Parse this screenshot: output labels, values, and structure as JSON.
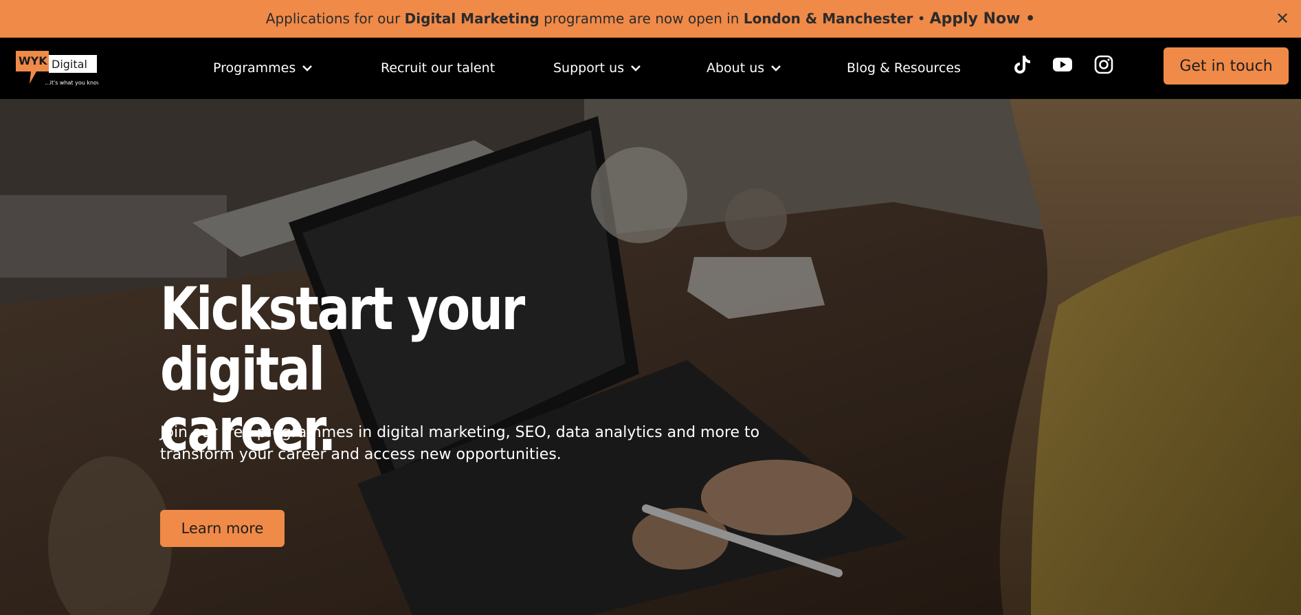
{
  "announcement": {
    "prefix": "Applications for our",
    "programme": "Digital Marketing",
    "middle": "programme are now open in",
    "locations": "London & Manchester",
    "separator": "•",
    "apply_label": "Apply Now",
    "apply_suffix": "•",
    "close_icon": "close-icon"
  },
  "logo": {
    "brand": "WYK",
    "word": "Digital",
    "tagline": "...it's what you know"
  },
  "nav": {
    "items": [
      {
        "label": "Programmes",
        "has_dropdown": true
      },
      {
        "label": "Recruit our talent",
        "has_dropdown": false
      },
      {
        "label": "Support us",
        "has_dropdown": true
      },
      {
        "label": "About us",
        "has_dropdown": true
      },
      {
        "label": "Blog & Resources",
        "has_dropdown": false
      }
    ],
    "social": [
      "tiktok-icon",
      "youtube-icon",
      "instagram-icon"
    ],
    "cta_label": "Get in touch"
  },
  "hero": {
    "title_line1": "Kickstart your digital",
    "title_line2": "career.",
    "subtitle_line1": "Join our free programmes in digital marketing, SEO, data analytics and more to",
    "subtitle_line2": "transform your career and access new opportunities.",
    "button_label": "Learn more"
  },
  "colors": {
    "accent": "#f08a48",
    "nav_bg": "#000000",
    "text_light": "#ffffff"
  }
}
